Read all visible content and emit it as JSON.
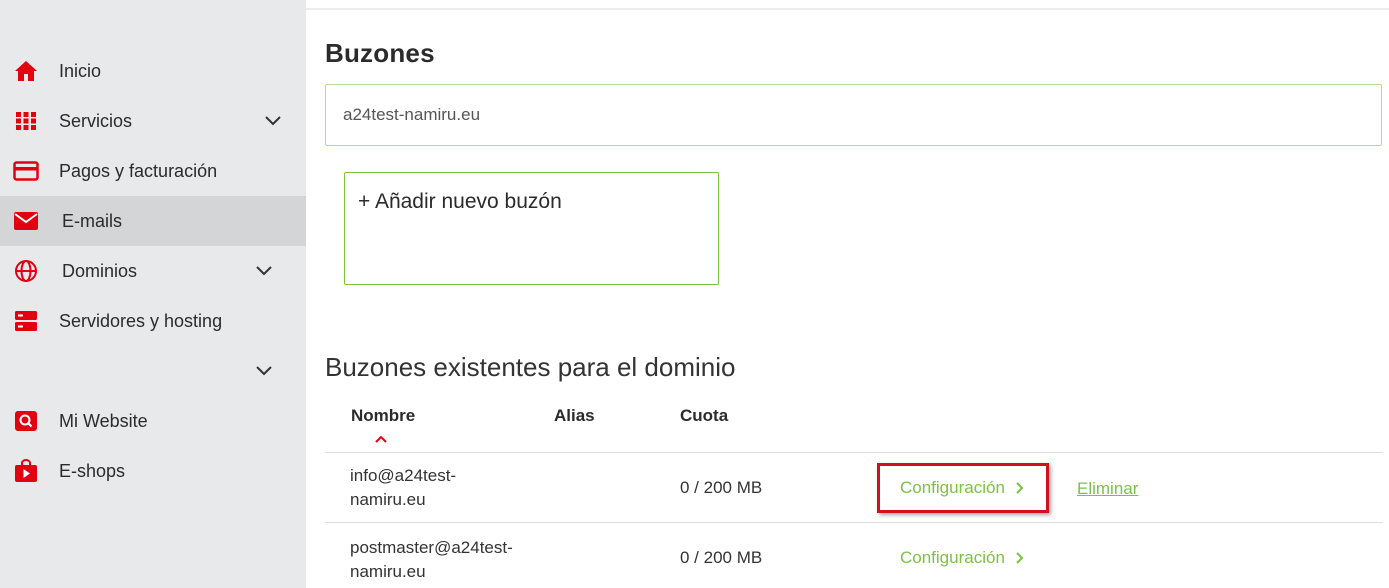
{
  "sidebar": {
    "items": [
      {
        "label": "Inicio",
        "icon": "home-icon"
      },
      {
        "label": "Servicios",
        "icon": "grid-icon"
      },
      {
        "label": "Pagos y facturación",
        "icon": "credit-card-icon"
      },
      {
        "label": "E-mails",
        "icon": "envelope-icon"
      },
      {
        "label": "Dominios",
        "icon": "globe-icon"
      },
      {
        "label": "Servidores y hosting",
        "icon": "server-icon"
      },
      {
        "label": "",
        "icon": ""
      },
      {
        "label": "Mi Website",
        "icon": "website-search-icon"
      },
      {
        "label": "E-shops",
        "icon": "shopping-bag-icon"
      }
    ]
  },
  "main": {
    "title": "Buzones",
    "domain_value": "a24test-namiru.eu",
    "add_label": "+ Añadir nuevo buzón",
    "section_title": "Buzones existentes para el dominio",
    "table": {
      "headers": {
        "name": "Nombre",
        "alias": "Alias",
        "quota": "Cuota"
      },
      "rows": [
        {
          "name_line1": "info@a24test-",
          "name_line2": "namiru.eu",
          "alias": "",
          "quota": "0 / 200 MB",
          "config": "Configuración",
          "delete": "Eliminar"
        },
        {
          "name_line1": "postmaster@a24test-",
          "name_line2": "namiru.eu",
          "alias": "",
          "quota": "0 / 200 MB",
          "config": "Configuración",
          "delete": ""
        }
      ]
    }
  },
  "colors": {
    "accent_red": "#e3000f",
    "link_green": "#7cc242",
    "highlight_red": "#d0111a",
    "sidebar_bg": "#e8e9ea",
    "sidebar_active": "#d3d5d7"
  }
}
